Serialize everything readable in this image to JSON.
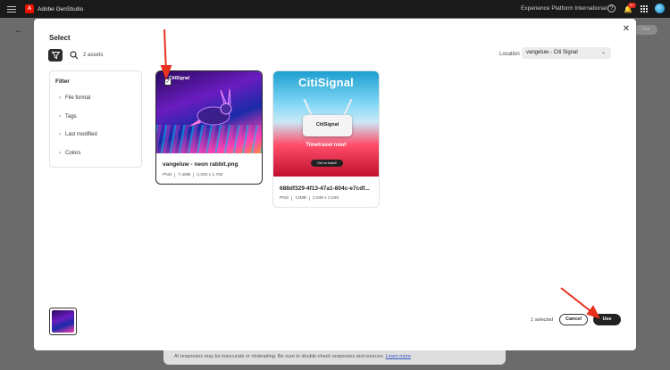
{
  "app": {
    "title": "Adobe GenStudio",
    "logo_letter": "A",
    "org_name": "Experience Platform International",
    "notification_count": "9+"
  },
  "background": {
    "use_label": "Use",
    "disclaimer": "AI responses may be inaccurate or misleading. Be sure to double-check responses and sources.",
    "learn_more": "Learn more"
  },
  "modal": {
    "title": "Select",
    "asset_count": "2 assets",
    "location_label": "Location",
    "location_value": "vangeluw - Citi Signal",
    "filter": {
      "title": "Filter",
      "items": [
        "File format",
        "Tags",
        "Last modified",
        "Colors"
      ]
    },
    "assets": [
      {
        "name": "vangeluw - neon rabbit.png",
        "type": "PNG",
        "size": "7.4MB",
        "dimensions": "2,304 x 1,792",
        "brand": "CitiSignal",
        "selected": true
      },
      {
        "name": "688df329-4f13-47a1-804c-e7cdf...",
        "type": "PNG",
        "size": "12MB",
        "dimensions": "2,048 x 2,048",
        "brand": "CitiSignal",
        "router_label": "CitiSignal",
        "tagline": "Timetravel now!",
        "cta": "Get on board!",
        "selected": false
      }
    ],
    "selected_count": "1 selected",
    "cancel_label": "Cancel",
    "use_label": "Use"
  },
  "colors": {
    "accent_red": "#eb1000",
    "annotation_arrow": "#e8321e",
    "primary_button": "#222222"
  }
}
